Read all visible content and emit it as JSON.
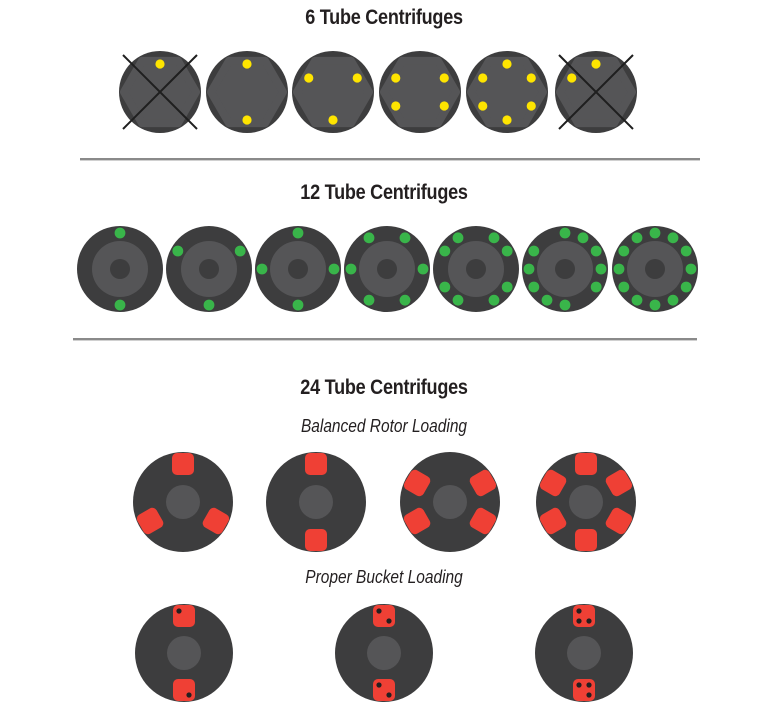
{
  "colors": {
    "rotor_outer": "#3d3d3e",
    "rotor_inner": "#555557",
    "hub": "#3d3d3e",
    "yellow_tube": "#ffe500",
    "green_tube": "#39b54a",
    "red_bucket": "#ef4035",
    "bucket_dot": "#231f20",
    "cross_line": "#1f1f1f"
  },
  "sections": {
    "six": {
      "title": "6 Tube Centrifuges",
      "rotors": [
        {
          "tubes": [
            0
          ],
          "capacity": 6,
          "crossed": true
        },
        {
          "tubes": [
            0,
            3
          ],
          "capacity": 6,
          "crossed": false
        },
        {
          "tubes": [
            1,
            3,
            5
          ],
          "capacity": 6,
          "crossed": false
        },
        {
          "tubes": [
            1,
            2,
            4,
            5
          ],
          "capacity": 6,
          "crossed": false
        },
        {
          "tubes": [
            0,
            1,
            2,
            3,
            4,
            5
          ],
          "capacity": 6,
          "crossed": false
        },
        {
          "tubes": [
            0,
            5
          ],
          "capacity": 6,
          "crossed": true
        }
      ]
    },
    "twelve": {
      "title": "12 Tube Centrifuges",
      "rotors": [
        {
          "tubes": [
            0,
            6
          ],
          "capacity": 12
        },
        {
          "tubes": [
            2,
            6,
            10
          ],
          "capacity": 12
        },
        {
          "tubes": [
            0,
            3,
            6,
            9
          ],
          "capacity": 12
        },
        {
          "tubes": [
            1,
            3,
            5,
            7,
            9,
            11
          ],
          "capacity": 12
        },
        {
          "tubes": [
            1,
            2,
            4,
            5,
            7,
            8,
            10,
            11
          ],
          "capacity": 12
        },
        {
          "tubes": [
            0,
            1,
            2,
            3,
            4,
            6,
            7,
            8,
            9,
            10
          ],
          "capacity": 12
        },
        {
          "tubes": [
            0,
            1,
            2,
            3,
            4,
            5,
            6,
            7,
            8,
            9,
            10,
            11
          ],
          "capacity": 12
        }
      ]
    },
    "twentyfour": {
      "title": "24 Tube Centrifuges",
      "balanced_subtitle": "Balanced Rotor Loading",
      "balanced_rotors": [
        {
          "buckets": [
            0,
            2,
            4
          ],
          "positions": 6
        },
        {
          "buckets": [
            0,
            3
          ],
          "positions": 6
        },
        {
          "buckets": [
            1,
            2,
            4,
            5
          ],
          "positions": 6
        },
        {
          "buckets": [
            0,
            1,
            2,
            3,
            4,
            5
          ],
          "positions": 6
        }
      ],
      "bucket_subtitle": "Proper Bucket Loading",
      "bucket_rotors": [
        {
          "top_bucket_tubes": [
            0
          ],
          "bottom_bucket_tubes": [
            3
          ]
        },
        {
          "top_bucket_tubes": [
            0,
            3
          ],
          "bottom_bucket_tubes": [
            0,
            3
          ]
        },
        {
          "top_bucket_tubes": [
            0,
            2,
            3
          ],
          "bottom_bucket_tubes": [
            0,
            1,
            3
          ]
        }
      ]
    }
  }
}
